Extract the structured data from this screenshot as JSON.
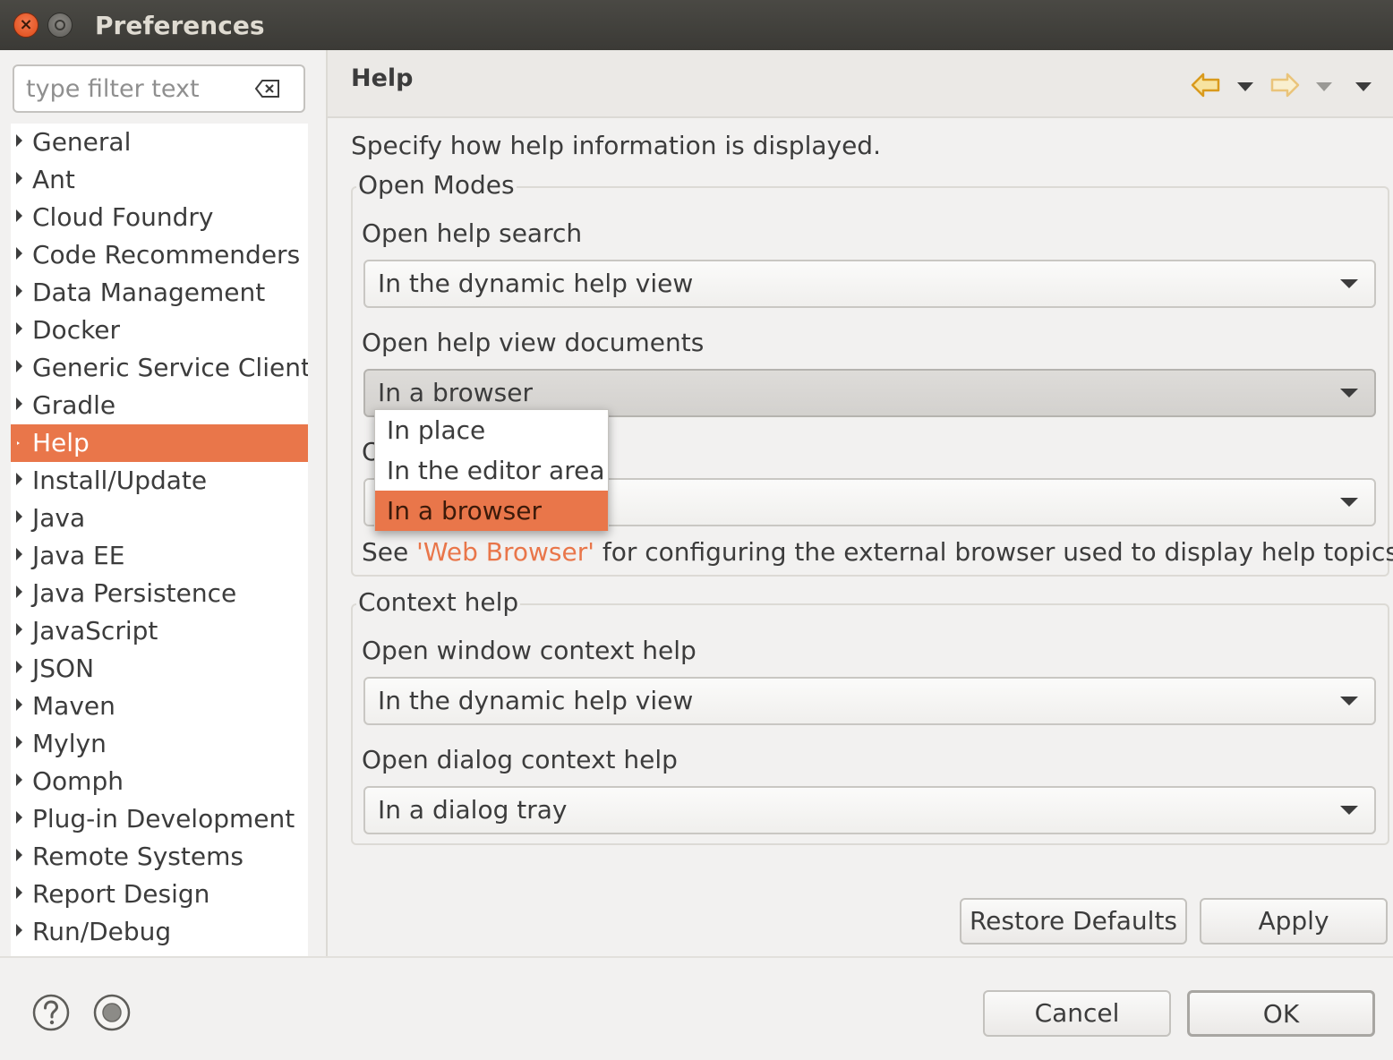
{
  "window": {
    "title": "Preferences"
  },
  "filter": {
    "placeholder": "type filter text"
  },
  "tree": {
    "items": [
      {
        "label": "General"
      },
      {
        "label": "Ant"
      },
      {
        "label": "Cloud Foundry"
      },
      {
        "label": "Code Recommenders"
      },
      {
        "label": "Data Management"
      },
      {
        "label": "Docker"
      },
      {
        "label": "Generic Service Client"
      },
      {
        "label": "Gradle"
      },
      {
        "label": "Help",
        "selected": true
      },
      {
        "label": "Install/Update"
      },
      {
        "label": "Java"
      },
      {
        "label": "Java EE"
      },
      {
        "label": "Java Persistence"
      },
      {
        "label": "JavaScript"
      },
      {
        "label": "JSON"
      },
      {
        "label": "Maven"
      },
      {
        "label": "Mylyn"
      },
      {
        "label": "Oomph"
      },
      {
        "label": "Plug-in Development"
      },
      {
        "label": "Remote Systems"
      },
      {
        "label": "Report Design"
      },
      {
        "label": "Run/Debug"
      }
    ]
  },
  "page": {
    "title": "Help",
    "description": "Specify how help information is displayed.",
    "open_modes": {
      "title": "Open Modes",
      "help_search_label": "Open help search",
      "help_search_value": "In the dynamic help view",
      "help_view_docs_label": "Open help view documents",
      "help_view_docs_value": "In a browser",
      "third_label_partial": "O",
      "see_prefix": "See ",
      "see_link": "'Web Browser'",
      "see_suffix": " for configuring the external browser used to display help topics."
    },
    "context_help": {
      "title": "Context help",
      "window_label": "Open window context help",
      "window_value": "In the dynamic help view",
      "dialog_label": "Open dialog context help",
      "dialog_value": "In a dialog tray"
    }
  },
  "dropdown_popup": {
    "options": [
      "In place",
      "In the editor area",
      "In a browser"
    ],
    "selected": "In a browser"
  },
  "buttons": {
    "restore_defaults": "Restore Defaults",
    "apply": "Apply",
    "cancel": "Cancel",
    "ok": "OK"
  },
  "colors": {
    "accent": "#e9764a",
    "titlebar": "#3b3a36",
    "background": "#f2f1f0"
  },
  "icons": {
    "back": "back-arrow-icon",
    "forward": "forward-arrow-icon",
    "help": "help-icon",
    "record": "record-icon",
    "clear": "clear-filter-icon"
  }
}
